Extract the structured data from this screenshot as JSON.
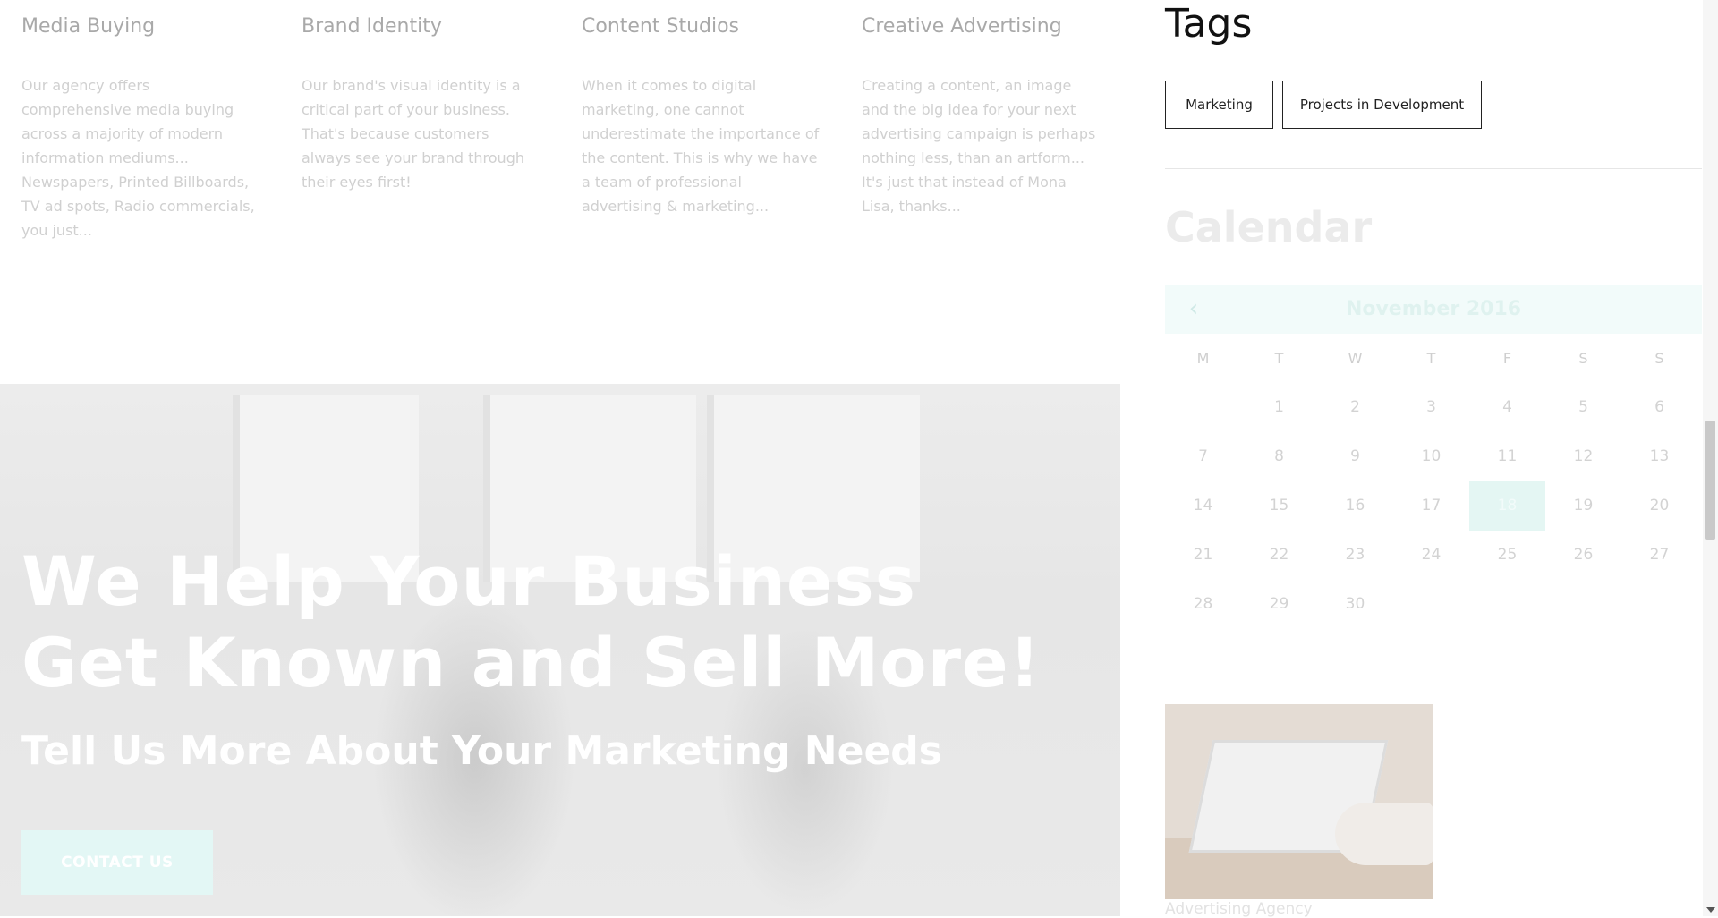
{
  "services": [
    {
      "title": "Media Buying",
      "text": "Our agency offers comprehensive media buying across a majority of modern information mediums... Newspapers, Printed Billboards, TV ad spots, Radio commercials, you just..."
    },
    {
      "title": "Brand Identity",
      "text": "Our brand's visual identity is a critical part of your business. That's because customers always see your brand through their eyes first!"
    },
    {
      "title": "Content Studios",
      "text": "When it comes to digital marketing, one cannot underestimate the importance of the content. This is why we have a team of professional advertising & marketing..."
    },
    {
      "title": "Creative Advertising",
      "text": "Creating a content, an image and the big idea for your next advertising campaign is perhaps nothing less, than an artform... It's just that instead of Mona Lisa, thanks..."
    }
  ],
  "hero": {
    "headline": "We Help Your Business Get Known and Sell More!",
    "subheadline": "Tell Us More About Your Marketing Needs",
    "cta_label": "CONTACT US"
  },
  "sidebar": {
    "tags_title": "Tags",
    "tags": [
      "Marketing",
      "Projects in Development"
    ],
    "calendar": {
      "title": "Calendar",
      "month_label": "November 2016",
      "prev_icon": "chevron-left-icon",
      "weekdays": [
        "M",
        "T",
        "W",
        "T",
        "F",
        "S",
        "S"
      ],
      "weeks": [
        [
          "",
          "1",
          "2",
          "3",
          "4",
          "5",
          "6"
        ],
        [
          "7",
          "8",
          "9",
          "10",
          "11",
          "12",
          "13"
        ],
        [
          "14",
          "15",
          "16",
          "17",
          "18",
          "19",
          "20"
        ],
        [
          "21",
          "22",
          "23",
          "24",
          "25",
          "26",
          "27"
        ],
        [
          "28",
          "29",
          "30",
          "",
          "",
          "",
          ""
        ]
      ],
      "active_day": "18"
    },
    "post_caption": "Advertising Agency"
  },
  "colors": {
    "accent": "#e4f6f3",
    "text_dark": "#111111",
    "text_muted": "#d0d0d0"
  }
}
